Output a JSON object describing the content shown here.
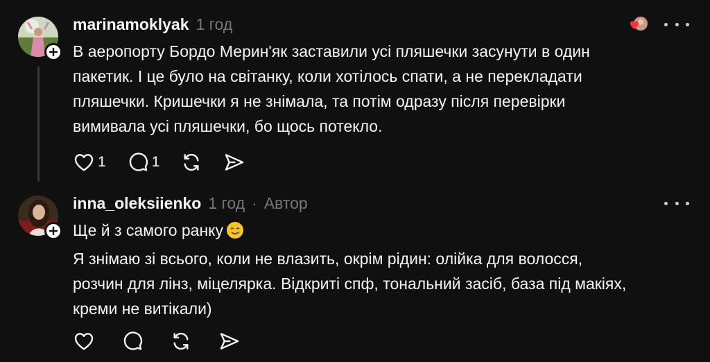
{
  "comments": [
    {
      "username": "marinamoklyak",
      "time": "1 год",
      "lines": [
        "В аеропорту Бордо Мерин'як заставили усі пляшечки засунути в один",
        "пакетик. І це було на світанку, коли хотілось спати, а не перекладати",
        "пляшечки. Кришечки я не знімала, та потім одразу після перевірки",
        "вимивала усі пляшечки, бо щось потекло."
      ],
      "like_count": "1",
      "reply_count": "1",
      "icons": [
        "heart-icon",
        "comment-icon",
        "repost-icon",
        "share-icon"
      ]
    },
    {
      "username": "inna_oleksiienko",
      "time": "1 год",
      "separator": "·",
      "author_badge": "Автор",
      "first_line": "Ще й з самого ранку",
      "first_line_emoji": "🥲",
      "lines": [
        "Я знімаю зі всього, коли не влазить, окрім рідин: олійка для волосся,",
        "розчин для лінз, міцелярка. Відкриті спф, тональний засіб, база під макіях,",
        "креми не витікали)"
      ],
      "icons": [
        "heart-icon",
        "comment-icon",
        "repost-icon",
        "share-icon"
      ]
    }
  ],
  "colors": {
    "background": "#101010",
    "text": "#f3f5f7",
    "muted": "#777777",
    "liked_heart": "#ff3040"
  }
}
